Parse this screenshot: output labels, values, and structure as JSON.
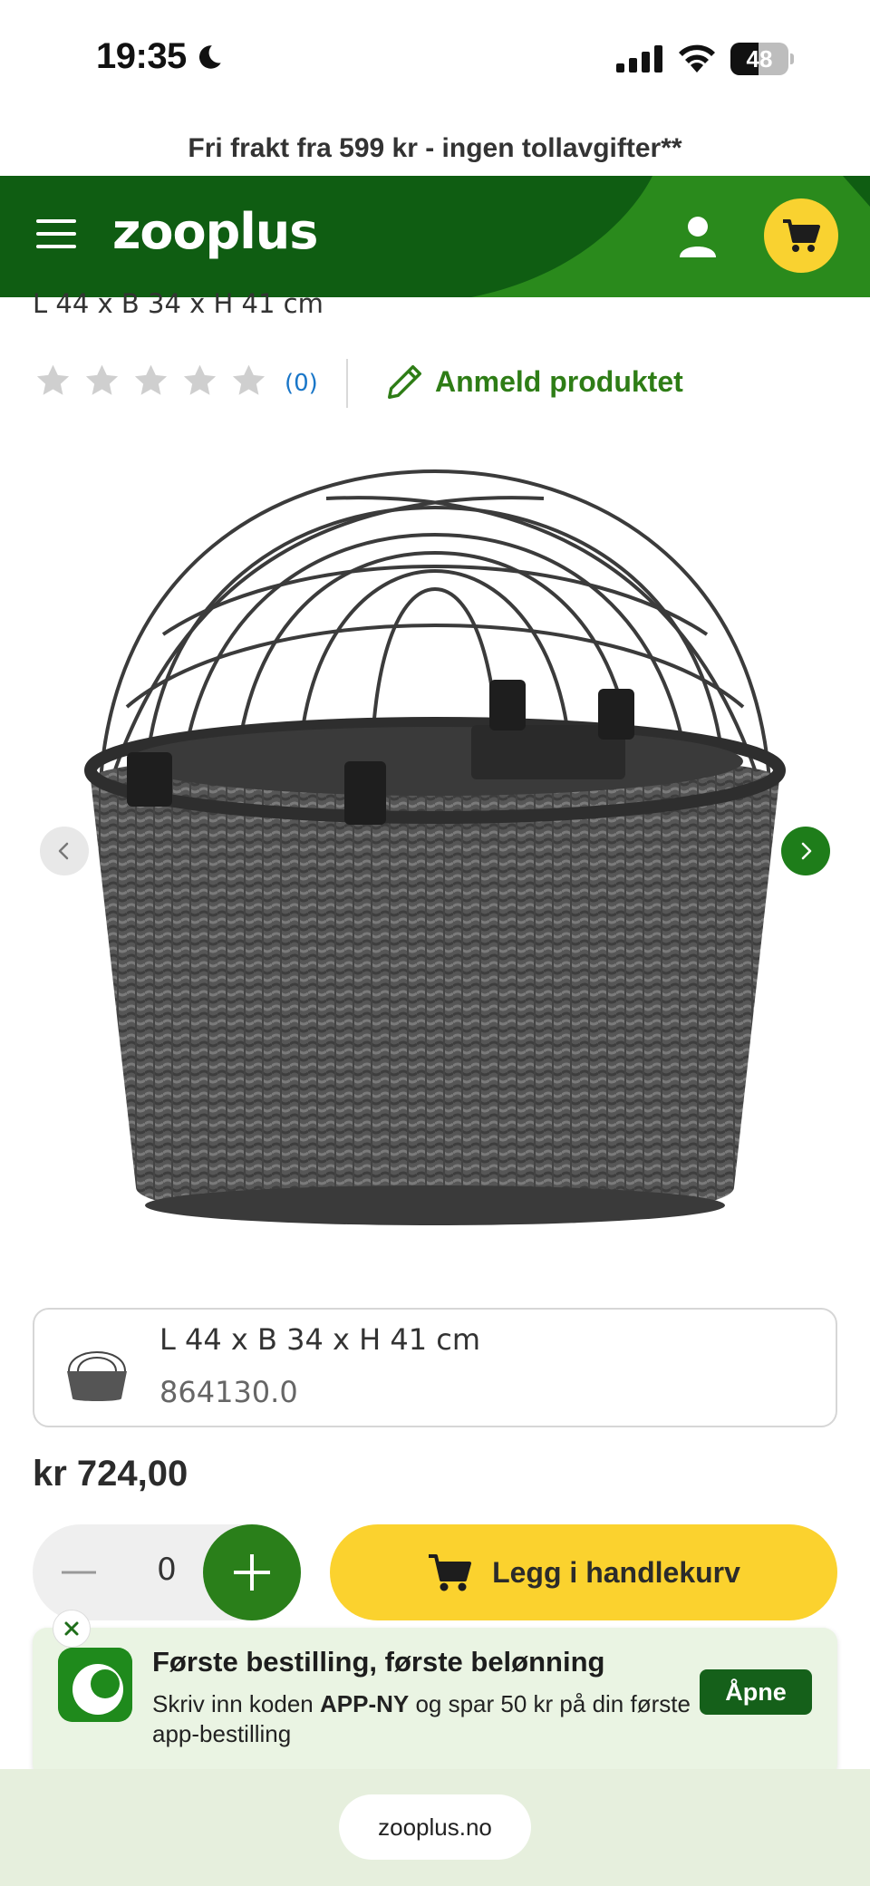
{
  "status_bar": {
    "time": "19:35",
    "battery": "48",
    "battery_level_percent": 48
  },
  "promo_strip": {
    "text": "Fri frakt fra 599 kr - ingen tollavgifter**"
  },
  "header": {
    "logo": "zooplus",
    "brand_color": "#0f5d12",
    "cart_color": "#f9d230"
  },
  "product": {
    "dims_peek": "L 44 x B 34 x H 41 cm",
    "rating": {
      "stars": 0,
      "max_stars": 5,
      "count": "(0)",
      "review_label": "Anmeld produktet"
    },
    "gallery": {
      "prev_icon": "chevron-left-icon",
      "next_icon": "chevron-right-icon"
    },
    "variant": {
      "name": "L 44 x B 34 x H 41 cm",
      "sku": "864130.0"
    },
    "price": "kr 724,00"
  },
  "purchase": {
    "quantity": "0",
    "add_to_cart_label": "Legg i handlekurv",
    "button_color": "#fbd22e"
  },
  "promo_banner": {
    "title": "Første bestilling, første belønning",
    "body_prefix": "Skriv inn koden ",
    "code": "APP-NY",
    "body_suffix": " og spar 50 kr på din første app-bestilling",
    "open_label": "Åpne"
  },
  "bottom_bar": {
    "url": "zooplus.no"
  }
}
